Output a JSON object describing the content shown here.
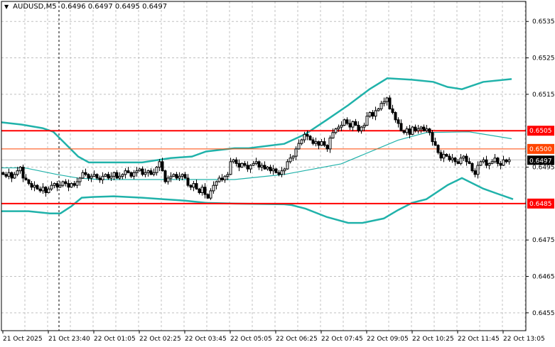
{
  "header": {
    "symbol": "AUDUSD,M5",
    "ohlc": "0.6496 0.6497 0.6495 0.6497"
  },
  "colors": {
    "bull_body": "#ffffff",
    "bear_body": "#000000",
    "bands": "#20b2aa",
    "level_major": "#ff0000",
    "level_minor": "#ff4500",
    "bid_line": "#c0c0c0",
    "grid": "#c0c0c0"
  },
  "chart_data": {
    "type": "candlestick",
    "title": "AUDUSD,M5",
    "timeframe_minutes": 5,
    "ylim": [
      0.64501,
      0.65405
    ],
    "grid": true,
    "x_tick_labels": [
      "21 Oct 2025",
      "21 Oct 23:40",
      "22 Oct 01:05",
      "22 Oct 02:25",
      "22 Oct 03:45",
      "22 Oct 05:05",
      "22 Oct 06:25",
      "22 Oct 07:45",
      "22 Oct 09:05",
      "22 Oct 10:25",
      "22 Oct 11:45",
      "22 Oct 13:05"
    ],
    "x_tick_bars": [
      0,
      16,
      32,
      48,
      64,
      80,
      96,
      112,
      128,
      144,
      160,
      176
    ],
    "y_tick_labels": [
      "0.6535",
      "0.6525",
      "0.6515",
      "0.6495",
      "0.6475",
      "0.6465",
      "0.6455"
    ],
    "y_tick_values": [
      0.6535,
      0.6525,
      0.6515,
      0.6495,
      0.6475,
      0.6465,
      0.6455
    ],
    "day_separator_bar": 20,
    "closes": [
      0.6493,
      0.64925,
      0.64935,
      0.6492,
      0.6493,
      0.6494,
      0.6495,
      0.6492,
      0.64915,
      0.64905,
      0.64895,
      0.649,
      0.6489,
      0.64885,
      0.64895,
      0.6488,
      0.6489,
      0.649,
      0.64905,
      0.64895,
      0.649,
      0.6491,
      0.64905,
      0.64895,
      0.64905,
      0.649,
      0.6491,
      0.6492,
      0.64935,
      0.6493,
      0.6492,
      0.64925,
      0.6493,
      0.6492,
      0.64915,
      0.64925,
      0.6493,
      0.6492,
      0.64925,
      0.64935,
      0.6492,
      0.64925,
      0.6493,
      0.6494,
      0.64935,
      0.64925,
      0.64935,
      0.6494,
      0.64945,
      0.6493,
      0.64935,
      0.6494,
      0.6493,
      0.64935,
      0.6495,
      0.64965,
      0.6494,
      0.6491,
      0.6492,
      0.64925,
      0.6493,
      0.6492,
      0.64925,
      0.6493,
      0.6492,
      0.649,
      0.64895,
      0.64905,
      0.6489,
      0.6488,
      0.64895,
      0.64875,
      0.64865,
      0.64885,
      0.649,
      0.6491,
      0.6492,
      0.64915,
      0.64925,
      0.6493,
      0.64965,
      0.6497,
      0.6496,
      0.6495,
      0.6496,
      0.64955,
      0.64945,
      0.64955,
      0.6496,
      0.64965,
      0.6495,
      0.64955,
      0.64945,
      0.6495,
      0.6494,
      0.64945,
      0.64935,
      0.6493,
      0.6494,
      0.64945,
      0.64965,
      0.64975,
      0.6498,
      0.65,
      0.65015,
      0.65025,
      0.6504,
      0.65035,
      0.65025,
      0.65015,
      0.6502,
      0.6501,
      0.6502,
      0.6501,
      0.65,
      0.6503,
      0.65045,
      0.65055,
      0.6506,
      0.65065,
      0.6508,
      0.6507,
      0.6506,
      0.65075,
      0.65065,
      0.6505,
      0.6506,
      0.65065,
      0.6509,
      0.651,
      0.6509,
      0.65105,
      0.6511,
      0.65125,
      0.6513,
      0.6514,
      0.6511,
      0.651,
      0.6508,
      0.6507,
      0.6505,
      0.65045,
      0.65055,
      0.6504,
      0.6506,
      0.6505,
      0.65055,
      0.6506,
      0.6505,
      0.65055,
      0.65045,
      0.6502,
      0.6501,
      0.6499,
      0.64975,
      0.64985,
      0.6498,
      0.6497,
      0.64975,
      0.64965,
      0.6496,
      0.64975,
      0.6498,
      0.64965,
      0.6496,
      0.6494,
      0.6493,
      0.64955,
      0.64965,
      0.6497,
      0.64955,
      0.6496,
      0.64965,
      0.64975,
      0.6496,
      0.64955,
      0.6497,
      0.64965,
      0.6497
    ],
    "bollinger": {
      "upper": [
        [
          -1,
          0.65073
        ],
        [
          6.5,
          0.65067
        ],
        [
          14,
          0.65057
        ],
        [
          17.75,
          0.65047
        ],
        [
          21.5,
          0.65018
        ],
        [
          26.5,
          0.64979
        ],
        [
          30.25,
          0.64963
        ],
        [
          49,
          0.64963
        ],
        [
          59,
          0.64975
        ],
        [
          66.5,
          0.64979
        ],
        [
          71.5,
          0.64993
        ],
        [
          81.5,
          0.65002
        ],
        [
          86.5,
          0.65002
        ],
        [
          99,
          0.65014
        ],
        [
          106.5,
          0.65041
        ],
        [
          114,
          0.6508
        ],
        [
          121.5,
          0.6512
        ],
        [
          129,
          0.65164
        ],
        [
          135.25,
          0.65194
        ],
        [
          144,
          0.6519
        ],
        [
          151.5,
          0.65184
        ],
        [
          156.5,
          0.6517
        ],
        [
          161.5,
          0.65164
        ],
        [
          169,
          0.65184
        ],
        [
          179,
          0.65192
        ]
      ],
      "middle": [
        [
          -1,
          0.64948
        ],
        [
          7.75,
          0.64948
        ],
        [
          19,
          0.6493
        ],
        [
          26.5,
          0.6492
        ],
        [
          34,
          0.64916
        ],
        [
          81.5,
          0.64916
        ],
        [
          99,
          0.6493
        ],
        [
          119,
          0.64959
        ],
        [
          139,
          0.65024
        ],
        [
          149,
          0.65045
        ],
        [
          164,
          0.65047
        ],
        [
          179,
          0.65028
        ]
      ],
      "lower": [
        [
          -1,
          0.64829
        ],
        [
          9,
          0.64829
        ],
        [
          16.5,
          0.64823
        ],
        [
          20.25,
          0.64823
        ],
        [
          24,
          0.64842
        ],
        [
          27.75,
          0.64866
        ],
        [
          31.5,
          0.64868
        ],
        [
          39,
          0.6487
        ],
        [
          49,
          0.64866
        ],
        [
          56.5,
          0.64862
        ],
        [
          64,
          0.64858
        ],
        [
          71.5,
          0.64852
        ],
        [
          81.5,
          0.6485
        ],
        [
          99,
          0.64848
        ],
        [
          101.5,
          0.64846
        ],
        [
          106.5,
          0.64836
        ],
        [
          114,
          0.64813
        ],
        [
          121.5,
          0.64797
        ],
        [
          126.5,
          0.64797
        ],
        [
          134,
          0.64809
        ],
        [
          139,
          0.64832
        ],
        [
          144,
          0.64852
        ],
        [
          149,
          0.64862
        ],
        [
          156.5,
          0.64901
        ],
        [
          161.5,
          0.6492
        ],
        [
          169,
          0.64891
        ],
        [
          174,
          0.64877
        ],
        [
          179.5,
          0.64862
        ]
      ]
    },
    "levels": [
      {
        "label": "0.6505",
        "value": 0.6505,
        "kind": "major"
      },
      {
        "label": "0.6500",
        "value": 0.65,
        "kind": "minor"
      },
      {
        "label": "0.6485",
        "value": 0.6485,
        "kind": "major"
      }
    ],
    "current_price": {
      "label": "0.6497",
      "value": 0.6497
    }
  }
}
